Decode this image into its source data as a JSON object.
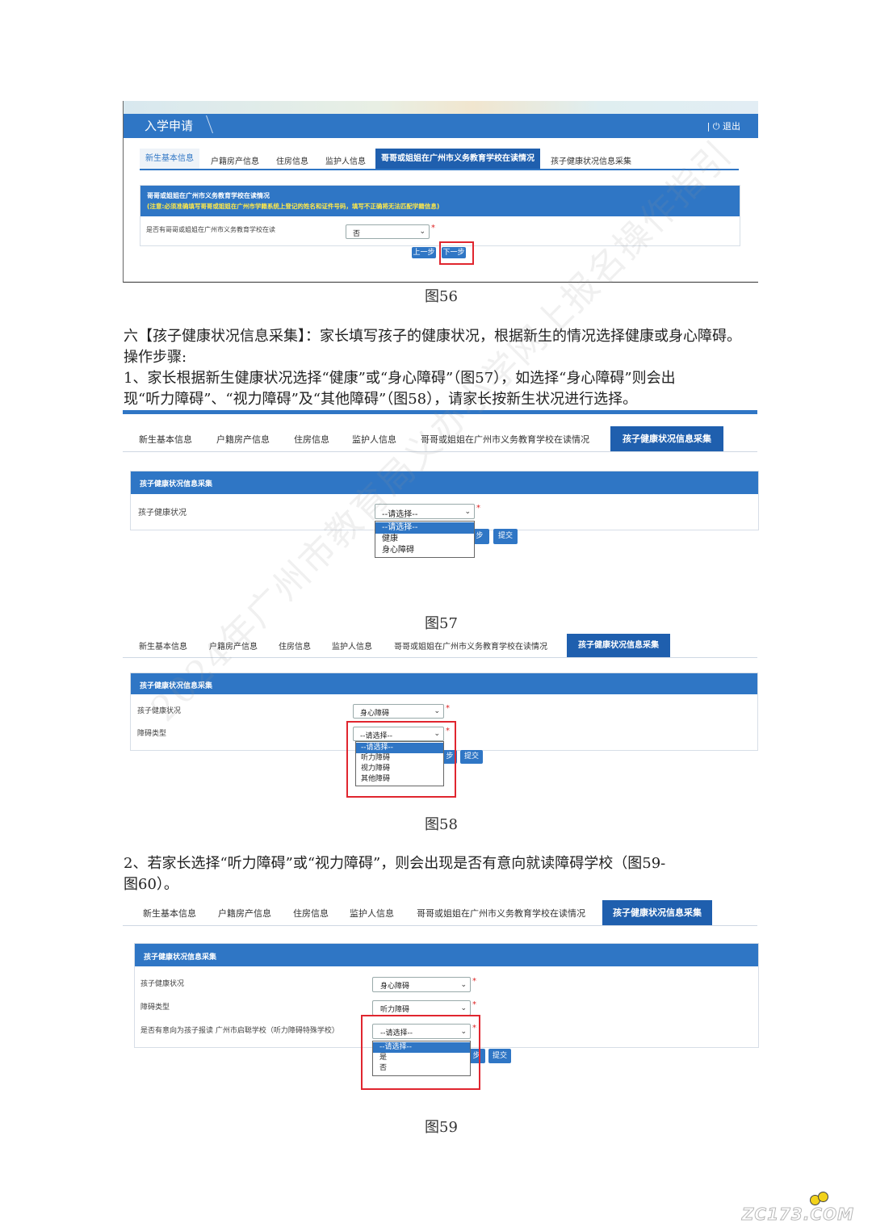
{
  "fig56": {
    "app_title": "入学申请",
    "logout": "退出",
    "tabs": [
      "新生基本信息",
      "户籍房产信息",
      "住房信息",
      "监护人信息",
      "哥哥或姐姐在广州市义务教育学校在读情况",
      "孩子健康状况信息采集"
    ],
    "active_tab": 4,
    "section_title": "哥哥或姐姐在广州市义务教育学校在读情况",
    "section_note": "(注意:必须准确填写哥哥或姐姐在广州市学籍系统上登记的姓名和证件号码，填写不正确将无法匹配学籍信息)",
    "field_label": "是否有哥哥或姐姐在广州市义务教育学校在读",
    "field_value": "否",
    "prev_button": "上一步",
    "next_button": "下一步",
    "caption": "图56"
  },
  "section6": {
    "line1": "六【孩子健康状况信息采集】：家长填写孩子的健康状况，根据新生的情况选择健康或身心障碍。",
    "line2": "操作步骤:",
    "line3": "1、家长根据新生健康状况选择“健康”或“身心障碍”（图57），如选择“身心障碍”则会出",
    "line4": "现“听力障碍”、“视力障碍”及“其他障碍”（图58），请家长按新生状况进行选择。"
  },
  "fig57": {
    "tabs": [
      "新生基本信息",
      "户籍房产信息",
      "住房信息",
      "监护人信息",
      "哥哥或姐姐在广州市义务教育学校在读情况",
      "孩子健康状况信息采集"
    ],
    "section_title": "孩子健康状况信息采集",
    "field_label": "孩子健康状况",
    "select_value": "--请选择--",
    "options": [
      "--请选择--",
      "健康",
      "身心障碍"
    ],
    "partial_button": "步",
    "submit_button": "提交",
    "caption": "图57"
  },
  "fig58": {
    "tabs": [
      "新生基本信息",
      "户籍房产信息",
      "住房信息",
      "监护人信息",
      "哥哥或姐姐在广州市义务教育学校在读情况",
      "孩子健康状况信息采集"
    ],
    "section_title": "孩子健康状况信息采集",
    "field1_label": "孩子健康状况",
    "field1_value": "身心障碍",
    "field2_label": "障碍类型",
    "field2_value": "--请选择--",
    "options": [
      "--请选择--",
      "听力障碍",
      "视力障碍",
      "其他障碍"
    ],
    "partial_button": "步",
    "submit_button": "提交",
    "caption": "图58"
  },
  "step2": {
    "line1": "2、若家长选择“听力障碍”或“视力障碍”，则会出现是否有意向就读障碍学校（图59-",
    "line2": "图60）。"
  },
  "fig59": {
    "tabs": [
      "新生基本信息",
      "户籍房产信息",
      "住房信息",
      "监护人信息",
      "哥哥或姐姐在广州市义务教育学校在读情况",
      "孩子健康状况信息采集"
    ],
    "section_title": "孩子健康状况信息采集",
    "field1_label": "孩子健康状况",
    "field1_value": "身心障碍",
    "field2_label": "障碍类型",
    "field2_value": "听力障碍",
    "field3_label": "是否有意向为孩子报读 广州市启聪学校（听力障碍特殊学校）",
    "field3_value": "--请选择--",
    "options": [
      "--请选择--",
      "是",
      "否"
    ],
    "partial_button": "步",
    "submit_button": "提交",
    "caption": "图59"
  },
  "watermark": "2024年广州市教育局义办小学网上报名操作指引",
  "site_logo": "ZC173.COM"
}
